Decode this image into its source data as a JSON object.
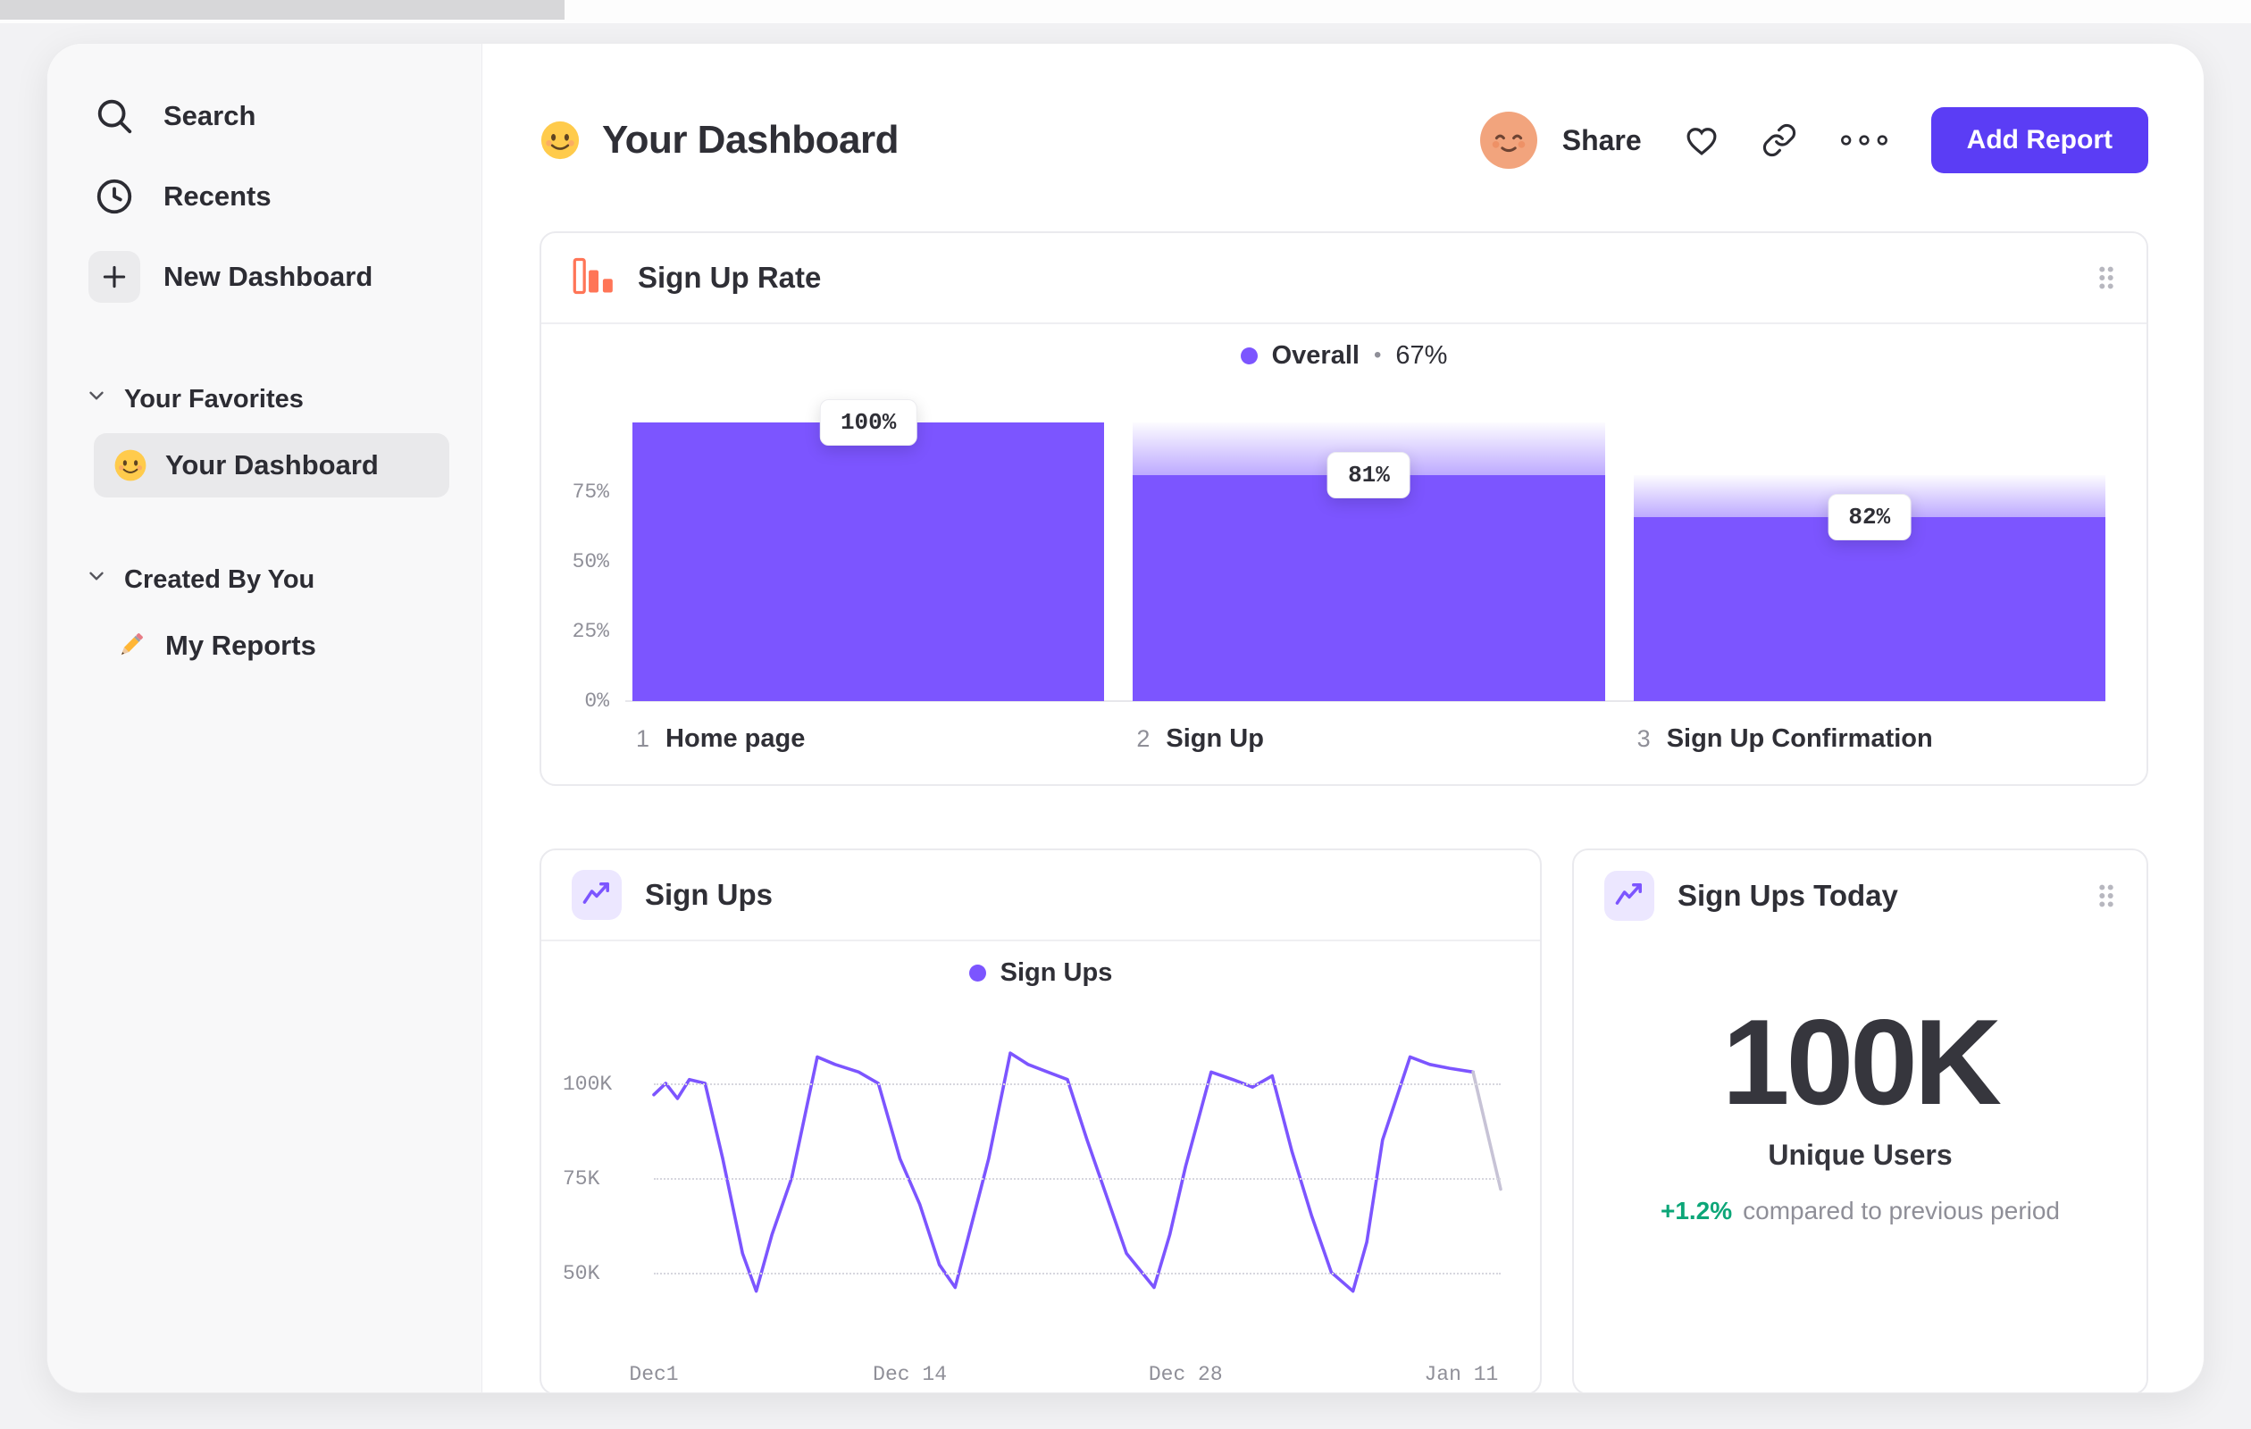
{
  "sidebar": {
    "nav": [
      {
        "label": "Search"
      },
      {
        "label": "Recents"
      },
      {
        "label": "New Dashboard"
      }
    ],
    "sections": [
      {
        "label": "Your Favorites",
        "items": [
          {
            "label": "Your Dashboard",
            "selected": true
          }
        ]
      },
      {
        "label": "Created By You",
        "items": [
          {
            "label": "My Reports",
            "selected": false
          }
        ]
      }
    ]
  },
  "header": {
    "title": "Your Dashboard",
    "share": "Share",
    "add_report": "Add Report"
  },
  "funnel_card": {
    "title": "Sign Up Rate",
    "legend": {
      "label": "Overall",
      "separator": "•",
      "value": "67%"
    }
  },
  "line_card": {
    "title": "Sign Ups",
    "legend": {
      "label": "Sign Ups"
    }
  },
  "kpi_card": {
    "title": "Sign Ups Today",
    "value": "100K",
    "label": "Unique Users",
    "delta": "+1.2%",
    "delta_text": "compared to previous period"
  },
  "colors": {
    "accent_purple": "#7c55ff",
    "button_purple": "#5b3df5",
    "orange": "#ff7557",
    "positive_green": "#0ca678"
  },
  "chart_data": [
    {
      "type": "bar",
      "subtype": "funnel",
      "title": "Sign Up Rate",
      "legend": [
        {
          "label": "Overall",
          "value_pct": 67
        }
      ],
      "categories": [
        "Home page",
        "Sign Up",
        "Sign Up Confirmation"
      ],
      "step_numbers": [
        1,
        2,
        3
      ],
      "step_conversion_pct": [
        100,
        81,
        82
      ],
      "cumulative_pct": [
        100,
        81,
        66
      ],
      "bar_labels": [
        "100%",
        "81%",
        "82%"
      ],
      "y_axis_ticks": [
        {
          "value": 75,
          "label": "75%"
        },
        {
          "value": 50,
          "label": "50%"
        },
        {
          "value": 25,
          "label": "25%"
        },
        {
          "value": 0,
          "label": "0%"
        }
      ],
      "ylim": [
        0,
        100
      ],
      "bar_color": "#7c55ff"
    },
    {
      "type": "line",
      "title": "Sign Ups",
      "legend": [
        "Sign Ups"
      ],
      "unit": "K",
      "x_max": 43,
      "y_plot_min": 35,
      "y_plot_max": 113,
      "y_ticks": [
        {
          "value": 100,
          "label": "100K"
        },
        {
          "value": 75,
          "label": "75K"
        },
        {
          "value": 50,
          "label": "50K"
        }
      ],
      "x_ticks": [
        {
          "day": 0,
          "label": "Dec1"
        },
        {
          "day": 13,
          "label": "Dec 14"
        },
        {
          "day": 27,
          "label": "Dec 28"
        },
        {
          "day": 41,
          "label": "Jan 11"
        }
      ],
      "points": [
        [
          0,
          97
        ],
        [
          0.6,
          100
        ],
        [
          1.2,
          96
        ],
        [
          1.8,
          101
        ],
        [
          2.6,
          100
        ],
        [
          3.5,
          80
        ],
        [
          4.5,
          55
        ],
        [
          5.2,
          45
        ],
        [
          6,
          60
        ],
        [
          7,
          75
        ],
        [
          8.3,
          107
        ],
        [
          9.2,
          105
        ],
        [
          10.4,
          103
        ],
        [
          11.4,
          100
        ],
        [
          12.5,
          80
        ],
        [
          13.5,
          68
        ],
        [
          14.5,
          52
        ],
        [
          15.3,
          46
        ],
        [
          16.1,
          62
        ],
        [
          17,
          80
        ],
        [
          18.1,
          108
        ],
        [
          19,
          105
        ],
        [
          20,
          103
        ],
        [
          21,
          101
        ],
        [
          22,
          85
        ],
        [
          23,
          70
        ],
        [
          24,
          55
        ],
        [
          25.4,
          46
        ],
        [
          26.2,
          60
        ],
        [
          27,
          78
        ],
        [
          28.3,
          103
        ],
        [
          29.4,
          101
        ],
        [
          30.4,
          99
        ],
        [
          31.4,
          102
        ],
        [
          32.4,
          82
        ],
        [
          33.4,
          65
        ],
        [
          34.4,
          50
        ],
        [
          35.5,
          45
        ],
        [
          36.2,
          58
        ],
        [
          37,
          85
        ],
        [
          38.4,
          107
        ],
        [
          39.4,
          105
        ],
        [
          40.4,
          104
        ],
        [
          41.6,
          103
        ]
      ],
      "points_trailing": [
        [
          41.6,
          103
        ],
        [
          43,
          72
        ]
      ],
      "line_color": "#7c55ff",
      "grid": "dotted-horizontal",
      "legend_position": "top-center"
    },
    {
      "type": "kpi",
      "title": "Sign Ups Today",
      "value": "100K",
      "label": "Unique Users",
      "change_pct": "+1.2%",
      "change_description": "compared to previous period"
    }
  ]
}
